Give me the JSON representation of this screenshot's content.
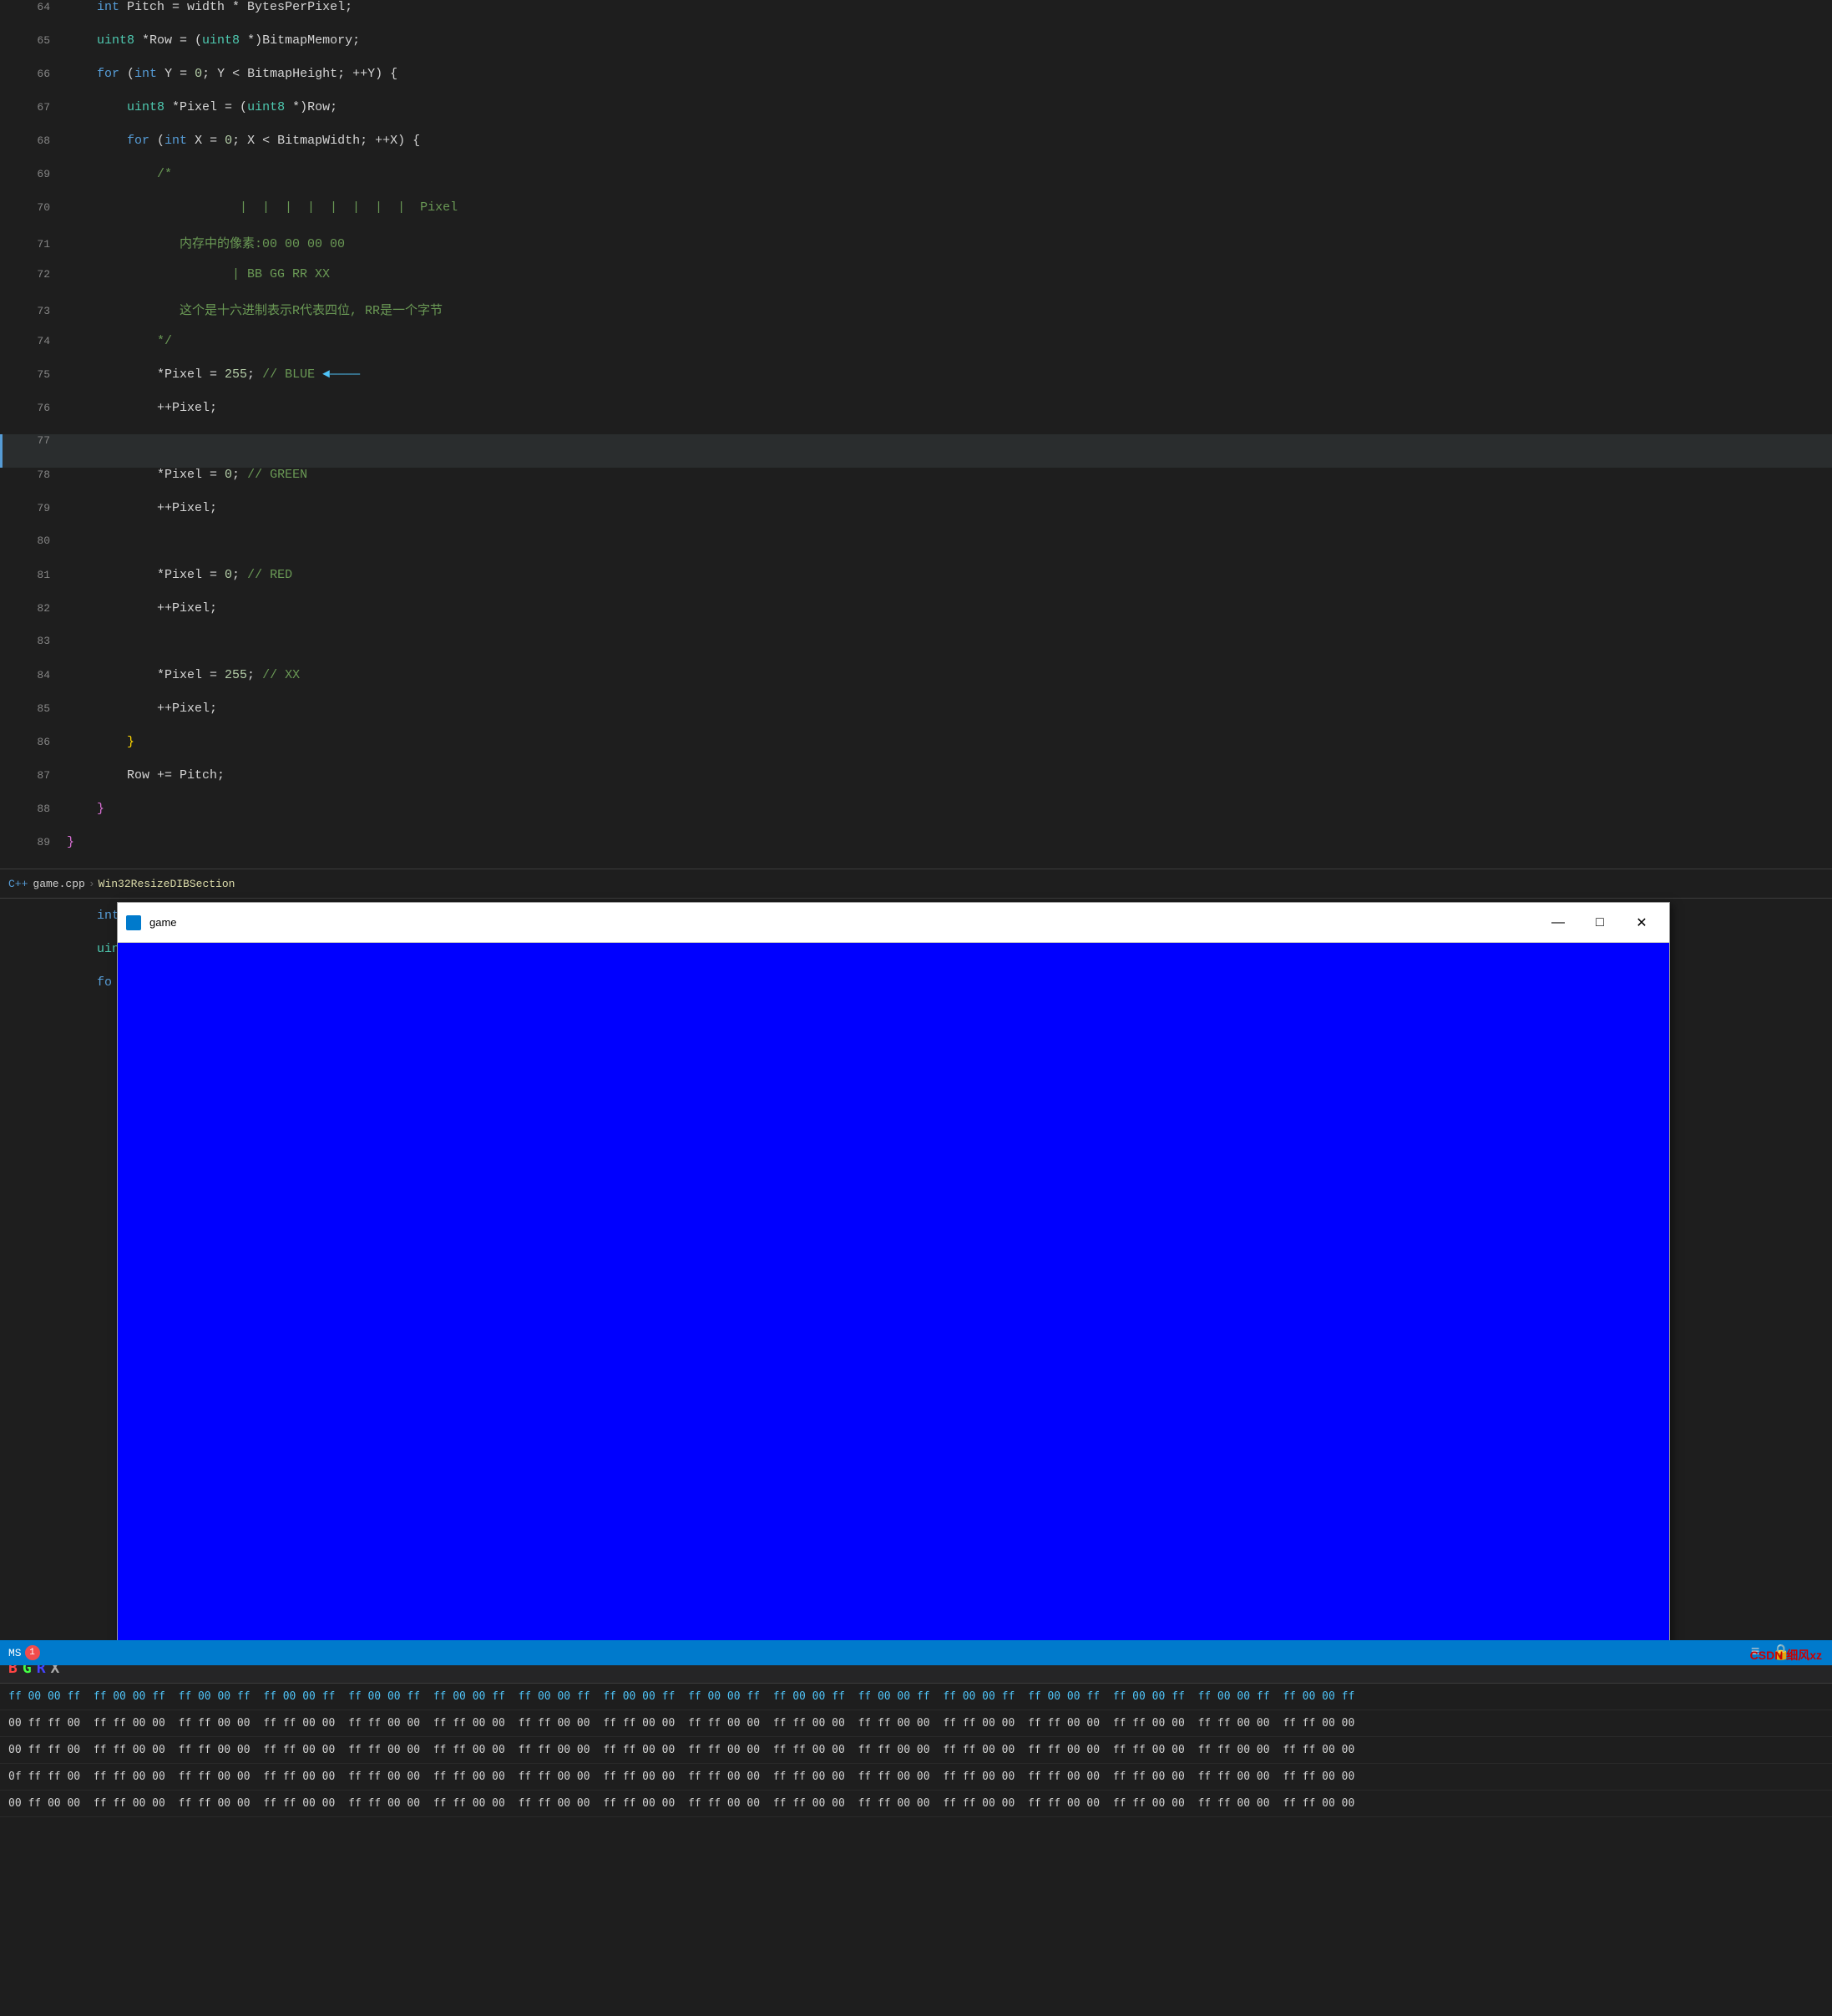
{
  "editor": {
    "lines": [
      {
        "num": "64",
        "tokens": [
          {
            "text": "    ",
            "cls": ""
          },
          {
            "text": "int",
            "cls": "kw"
          },
          {
            "text": " Pitch = width * BytesPerPixel;",
            "cls": ""
          }
        ]
      },
      {
        "num": "65",
        "tokens": [
          {
            "text": "    ",
            "cls": ""
          },
          {
            "text": "uint8",
            "cls": "type"
          },
          {
            "text": " *Row = (",
            "cls": ""
          },
          {
            "text": "uint8",
            "cls": "type"
          },
          {
            "text": " *)BitmapMemory;",
            "cls": ""
          }
        ]
      },
      {
        "num": "66",
        "tokens": [
          {
            "text": "    ",
            "cls": ""
          },
          {
            "text": "for",
            "cls": "kw"
          },
          {
            "text": " (",
            "cls": ""
          },
          {
            "text": "int",
            "cls": "kw"
          },
          {
            "text": " Y = ",
            "cls": ""
          },
          {
            "text": "0",
            "cls": "num"
          },
          {
            "text": "; Y < BitmapHeight; ++Y) {",
            "cls": ""
          }
        ]
      },
      {
        "num": "67",
        "tokens": [
          {
            "text": "        ",
            "cls": ""
          },
          {
            "text": "uint8",
            "cls": "type"
          },
          {
            "text": " *Pixel = (",
            "cls": ""
          },
          {
            "text": "uint8",
            "cls": "type"
          },
          {
            "text": " *)Row;",
            "cls": ""
          }
        ]
      },
      {
        "num": "68",
        "tokens": [
          {
            "text": "        ",
            "cls": ""
          },
          {
            "text": "for",
            "cls": "kw"
          },
          {
            "text": " (",
            "cls": ""
          },
          {
            "text": "int",
            "cls": "kw"
          },
          {
            "text": " X = ",
            "cls": ""
          },
          {
            "text": "0",
            "cls": "num"
          },
          {
            "text": "; X < BitmapWidth; ++X) {",
            "cls": ""
          }
        ]
      },
      {
        "num": "69",
        "tokens": [
          {
            "text": "            /*",
            "cls": "comment"
          }
        ]
      },
      {
        "num": "70",
        "tokens": [
          {
            "text": "                       |  |  |  |  |  |  |  |  Pixel",
            "cls": "comment"
          }
        ]
      },
      {
        "num": "71",
        "tokens": [
          {
            "text": "               内存中的像素:00 00 00 00",
            "cls": "cn-comment"
          }
        ]
      },
      {
        "num": "72",
        "tokens": [
          {
            "text": "                      | BB GG RR XX",
            "cls": "cn-comment"
          }
        ]
      },
      {
        "num": "73",
        "tokens": [
          {
            "text": "               这个是十六进制表示R代表四位, RR是一个字节",
            "cls": "cn-comment"
          }
        ]
      },
      {
        "num": "74",
        "tokens": [
          {
            "text": "            */",
            "cls": "comment"
          }
        ]
      },
      {
        "num": "75",
        "tokens": [
          {
            "text": "            *Pixel = ",
            "cls": ""
          },
          {
            "text": "255",
            "cls": "num"
          },
          {
            "text": "; ",
            "cls": ""
          },
          {
            "text": "// BLUE",
            "cls": "comment"
          },
          {
            "text": "  ◄————",
            "cls": "arrow-blue"
          }
        ]
      },
      {
        "num": "76",
        "tokens": [
          {
            "text": "            ++Pixel;",
            "cls": ""
          }
        ]
      },
      {
        "num": "77",
        "tokens": [],
        "current": true
      },
      {
        "num": "78",
        "tokens": [
          {
            "text": "            *Pixel = ",
            "cls": ""
          },
          {
            "text": "0",
            "cls": "num"
          },
          {
            "text": "; ",
            "cls": ""
          },
          {
            "text": "// GREEN",
            "cls": "comment"
          }
        ]
      },
      {
        "num": "79",
        "tokens": [
          {
            "text": "            ++Pixel;",
            "cls": ""
          }
        ]
      },
      {
        "num": "80",
        "tokens": []
      },
      {
        "num": "81",
        "tokens": [
          {
            "text": "            *Pixel = ",
            "cls": ""
          },
          {
            "text": "0",
            "cls": "num"
          },
          {
            "text": "; ",
            "cls": ""
          },
          {
            "text": "// RED",
            "cls": "comment"
          }
        ]
      },
      {
        "num": "82",
        "tokens": [
          {
            "text": "            ++Pixel;",
            "cls": ""
          }
        ]
      },
      {
        "num": "83",
        "tokens": []
      },
      {
        "num": "84",
        "tokens": [
          {
            "text": "            *Pixel = ",
            "cls": ""
          },
          {
            "text": "255",
            "cls": "num"
          },
          {
            "text": "; ",
            "cls": ""
          },
          {
            "text": "// XX",
            "cls": "comment"
          }
        ]
      },
      {
        "num": "85",
        "tokens": [
          {
            "text": "            ++Pixel;",
            "cls": ""
          }
        ]
      },
      {
        "num": "86",
        "tokens": [
          {
            "text": "        }",
            "cls": ""
          }
        ]
      },
      {
        "num": "87",
        "tokens": [
          {
            "text": "        Row += Pitch;",
            "cls": ""
          }
        ]
      },
      {
        "num": "88",
        "tokens": [
          {
            "text": "    }",
            "cls": ""
          }
        ]
      },
      {
        "num": "89",
        "tokens": [
          {
            "text": "}",
            "cls": ""
          }
        ]
      }
    ],
    "breadcrumb": {
      "file": "C++  game.cpp",
      "sep1": "›",
      "class": "Win32ResizeDIBSection",
      "code_preview": "int  Pitch = width * BytesPerPixel;"
    }
  },
  "floating_window": {
    "title": "game",
    "min_label": "—",
    "max_label": "□",
    "close_label": "✕"
  },
  "hex_display": {
    "labels": [
      "B",
      "G",
      "R",
      "X"
    ],
    "rows": [
      "ff 00 00 ff  ff 00 00 ff  ff 00 00 ff  ff 00 00 ff  ff 00 00 ff  ff 00 00 ff  ff 00 00 ff  ff 00 00 ff",
      "00 ff ff 00  ff ff 00 00  ff ff 00 00  ff ff 00 00  ff ff 00 00  ff ff 00 00  ff ff 00 00  ff ff 00 00",
      "00 ff ff 00  ff ff 00 00  ff ff 00 00  ff ff 00 00  ff ff 00 00  ff ff 00 00  ff ff 00 00  ff ff 00 00",
      "0f ff ff 00  ff ff 00 00  ff ff 00 00  ff ff 00 00  ff ff 00 00  ff ff 00 00  ff ff 00 00  ff ff 00 00",
      "00 ff 00 00  ff ff 00 00  ff ff 00 00  ff ff 00 00  ff ff 00 00  ff ff 00 00  ff ff 00 00  ff ff 00 00"
    ]
  },
  "status_bar": {
    "ms_label": "MS",
    "badge_count": "1",
    "icons": [
      "≡",
      "🔒"
    ]
  },
  "csdn": {
    "text": "CSDN 细风xz"
  }
}
